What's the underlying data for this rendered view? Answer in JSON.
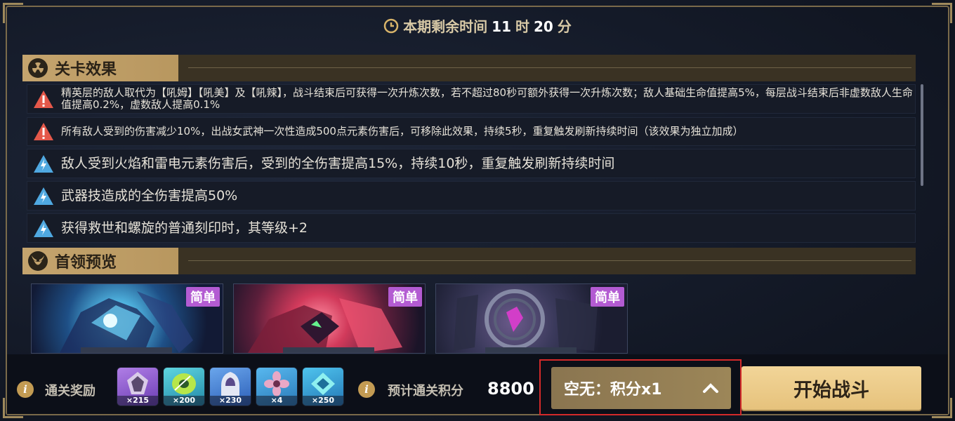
{
  "timer": {
    "prefix": "本期剩余时间",
    "hours": "11",
    "hours_unit": "时",
    "minutes": "20",
    "minutes_unit": "分"
  },
  "stage_effects": {
    "title": "关卡效果",
    "items": [
      {
        "icon": "warning-triangle-icon",
        "text": "精英层的敌人取代为【吼姆】【吼美】及【吼辣】，战斗结束后可获得一次升炼次数，若不超过80秒可额外获得一次升炼次数；敌人基础生命值提高5%，每层战斗结束后非虚数敌人生命值提高0.2%，虚数敌人提高0.1%"
      },
      {
        "icon": "warning-triangle-icon",
        "text": "所有敌人受到的伤害减少10%，出战女武神一次性造成500点元素伤害后，可移除此效果，持续5秒，重复触发刷新持续时间（该效果为独立加成）"
      },
      {
        "icon": "lightning-triangle-icon",
        "text": "敌人受到火焰和雷电元素伤害后，受到的全伤害提高15%，持续10秒，重复触发刷新持续时间"
      },
      {
        "icon": "lightning-triangle-icon",
        "text": "武器技造成的全伤害提高50%"
      },
      {
        "icon": "lightning-triangle-icon",
        "text": "获得救世和螺旋的普通刻印时，其等级+2"
      }
    ]
  },
  "boss_preview": {
    "title": "首领预览",
    "bosses": [
      {
        "difficulty": "简单"
      },
      {
        "difficulty": "简单"
      },
      {
        "difficulty": "简单"
      }
    ]
  },
  "rewards": {
    "label": "通关奖励",
    "items": [
      {
        "name": "purple-crystal-item-icon",
        "count": "×215",
        "color": "#8e5bd0"
      },
      {
        "name": "green-disc-item-icon",
        "count": "×200",
        "color": "#2fb6c9"
      },
      {
        "name": "hooded-figure-item-icon",
        "count": "×230",
        "color": "#3f7fd1"
      },
      {
        "name": "pink-flower-item-icon",
        "count": "×4",
        "color": "#3c9ad6"
      },
      {
        "name": "blue-crystal-item-icon",
        "count": "×250",
        "color": "#2fa8d8"
      }
    ]
  },
  "score": {
    "label": "预计通关积分",
    "value": "8800"
  },
  "ticket_select": {
    "label": "空无：积分x1"
  },
  "start_button": {
    "label": "开始战斗"
  }
}
